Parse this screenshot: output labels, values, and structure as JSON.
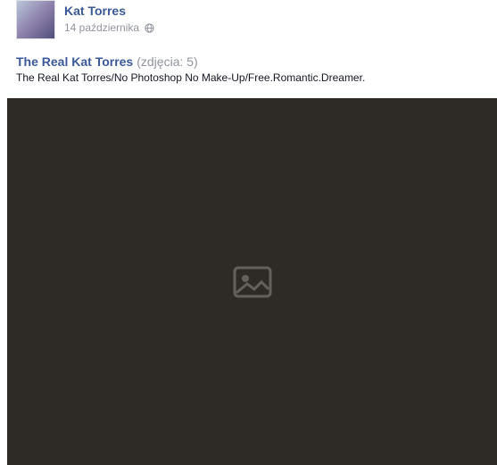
{
  "post": {
    "author": "Kat Torres",
    "date": "14 października",
    "privacy_icon": "globe-icon"
  },
  "album": {
    "title": "The Real Kat Torres",
    "count_label": "(zdjęcia: 5)",
    "caption": "The Real Kat Torres/No Photoshop No Make-Up/Free.Romantic.Dreamer."
  },
  "photo": {
    "icon": "image-placeholder-icon"
  },
  "colors": {
    "link": "#3b5998",
    "meta": "#90949c",
    "text": "#141823"
  }
}
